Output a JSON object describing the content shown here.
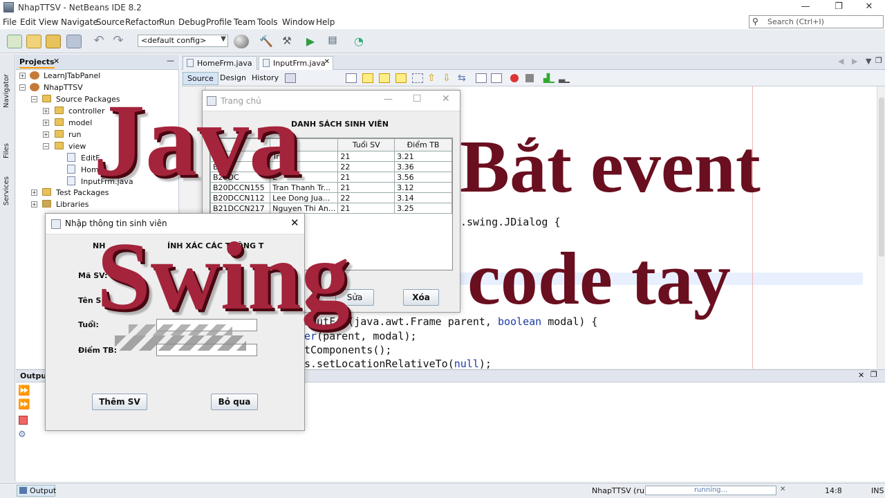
{
  "window": {
    "title": "NhapTTSV - NetBeans IDE 8.2",
    "search_placeholder": "Search (Ctrl+I)"
  },
  "menus": [
    "File",
    "Edit",
    "View",
    "Navigate",
    "Source",
    "Refactor",
    "Run",
    "Debug",
    "Profile",
    "Team",
    "Tools",
    "Window",
    "Help"
  ],
  "toolbar": {
    "config_value": "<default config>"
  },
  "sidestrip": {
    "navigator": "Navigator",
    "files": "Files",
    "services": "Services"
  },
  "projects": {
    "title": "Projects",
    "items": [
      "LearnJTabPanel",
      "NhapTTSV",
      "Source Packages",
      "controller",
      "model",
      "run",
      "view",
      "EditF",
      "Home",
      "InputFrm.java",
      "Test Packages",
      "Libraries"
    ]
  },
  "editor": {
    "tabs": [
      "HomeFrm.java",
      "InputFrm.java"
    ],
    "subtabs": [
      "Source",
      "Design",
      "History"
    ],
    "code": {
      "l1": ".swing.JDialog {",
      "l2a": "nputFrm(java.awt.Frame parent, ",
      "l2kw": "boolean",
      "l2b": " modal) {",
      "l3a": "er",
      "l3b": "(parent, modal);",
      "l4": "tComponents();",
      "l5a": "s.setLocationRelativeTo(",
      "l5kw": "null",
      "l5b": ");"
    }
  },
  "output": {
    "title": "Output"
  },
  "statusbar": {
    "output_tab": "Output",
    "project_run": "NhapTTSV (run)",
    "running": "running...",
    "position": "14:8",
    "mode": "INS"
  },
  "dialog_main": {
    "title": "Trang chủ",
    "heading": "DANH SÁCH SINH VIÊN",
    "headers": [
      "",
      "",
      "Tuổi SV",
      "Điểm TB"
    ],
    "rows": [
      [
        "B19",
        "Tr",
        "21",
        "3.21"
      ],
      [
        "B19D",
        "",
        "22",
        "3.36"
      ],
      [
        "B20DC",
        "L",
        "21",
        "3.56"
      ],
      [
        "B20DCCN155",
        "Tran Thanh Tr...",
        "21",
        "3.12"
      ],
      [
        "B20DCCN112",
        "Lee Dong Jua...",
        "22",
        "3.14"
      ],
      [
        "B21DCCN217",
        "Nguyen Thi An...",
        "21",
        "3.25"
      ]
    ],
    "btn_edit": "Sửa",
    "btn_delete": "Xóa"
  },
  "dialog_input": {
    "title": "Nhập thông tin sinh viên",
    "heading_left": "NH",
    "heading_right": "ÍNH XÁC CÁC THÔNG T",
    "label_id": "Mã SV:",
    "label_name": "Tên S",
    "label_age": "Tuổi:",
    "label_gpa": "Điểm TB:",
    "btn_add": "Thêm SV",
    "btn_skip": "Bỏ qua"
  },
  "overlay": {
    "java": "Java",
    "swing": "Swing",
    "bat_event": "Bắt event",
    "code_tay": "code tay"
  },
  "colors": {
    "overlay_red": "#a4243b",
    "overlay_dark": "#6a0f1f",
    "menu_bg": "#ffffff",
    "toolbar_bg": "#e9edf2"
  }
}
